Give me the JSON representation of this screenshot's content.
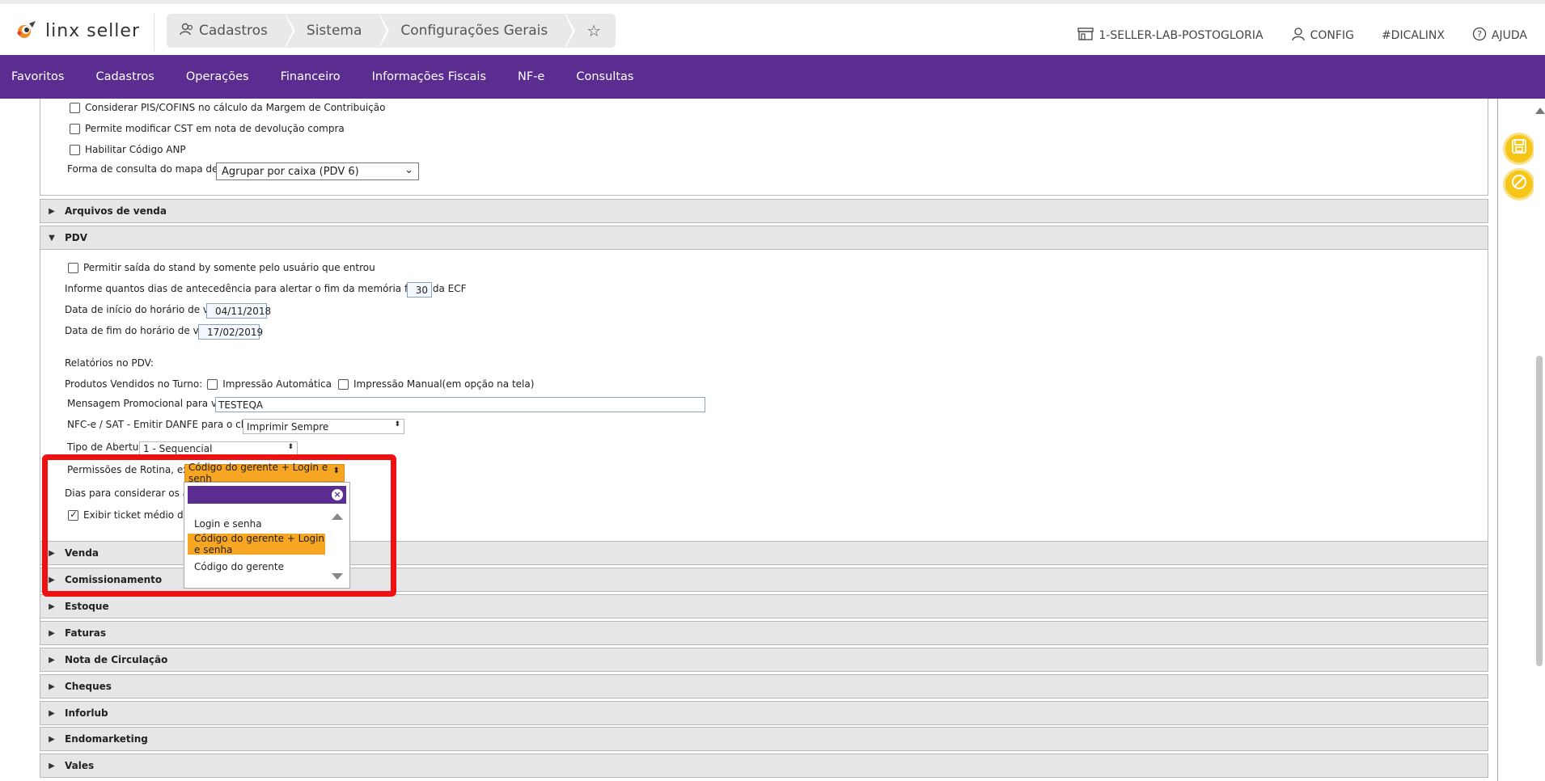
{
  "header": {
    "logo_text": "linx seller",
    "breadcrumbs": [
      {
        "label": "Cadastros"
      },
      {
        "label": "Sistema"
      },
      {
        "label": "Configurações Gerais"
      }
    ],
    "store": "1-SELLER-LAB-POSTOGLORIA",
    "config": "CONFIG",
    "hashtag": "#DICALINX",
    "help": "AJUDA"
  },
  "nav": {
    "items": [
      "Favoritos",
      "Cadastros",
      "Operações",
      "Financeiro",
      "Informações Fiscais",
      "NF-e",
      "Consultas"
    ]
  },
  "top_section": {
    "cb1": "Considerar PIS/COFINS no cálculo da Margem de Contribuição",
    "cb2": "Permite modificar CST em nota de devolução compra",
    "cb3": "Habilitar Código ANP",
    "pista_label": "Forma de consulta do mapa de pista",
    "pista_value": "Agrupar por caixa (PDV 6)"
  },
  "sections": {
    "arquivos": "Arquivos de venda",
    "pdv": "PDV",
    "venda": "Venda",
    "comissionamento": "Comissionamento",
    "estoque": "Estoque",
    "faturas": "Faturas",
    "nota": "Nota de Circulação",
    "cheques": "Cheques",
    "inforlub": "Inforlub",
    "endomarketing": "Endomarketing",
    "vales": "Vales"
  },
  "pdv": {
    "standby_label": "Permitir saída do stand by somente pelo usuário que entrou",
    "dias_ecf_label": "Informe quantos dias de antecedência para alertar o fim da memória fiscal da ECF",
    "dias_ecf_value": "30",
    "inicio_label": "Data de início do horário de verão",
    "inicio_value": "04/11/2018",
    "fim_label": "Data de fim do horário de verão",
    "fim_value": "17/02/2019",
    "relatorios_label": "Relatórios no PDV:",
    "produtos_label": "Produtos Vendidos no Turno:",
    "impressao_auto": "Impressão Automática",
    "impressao_manual": "Impressão Manual(em opção na tela)",
    "msg_label": "Mensagem Promocional para venda",
    "msg_value": "TESTEQA",
    "nfce_label": "NFC-e / SAT - Emitir DANFE para o cliente",
    "nfce_value": "Imprimir Sempre",
    "abertura_label": "Tipo de Abertura",
    "abertura_value": "1 - Sequencial",
    "permissoes_label": "Permissões de Rotina, exibir",
    "permissoes_value": "Código do gerente + Login e senh",
    "dias_arq_label": "Dias para considerar os arqui",
    "ticket_label": "Exibir ticket médio do tu"
  },
  "dropdown": {
    "options": [
      "Login e senha",
      "Código do gerente + Login e senha",
      "Código do gerente"
    ],
    "selected_index": 1,
    "accent": "#f6a623",
    "header_color": "#5c2d91"
  },
  "colors": {
    "nav_bg": "#5c2d91",
    "highlight": "#ee1111",
    "fab": "#f5c518"
  }
}
